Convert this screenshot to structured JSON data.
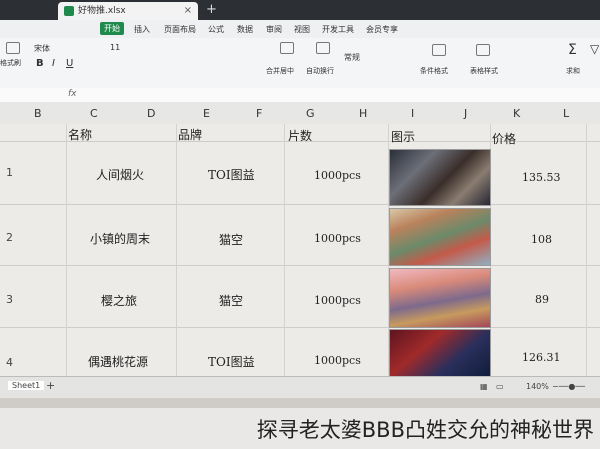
{
  "window": {
    "tab_title": "好物推.xlsx",
    "tab_close": "×",
    "new_tab": "+"
  },
  "ribbon_tabs": [
    "开始",
    "插入",
    "页面布局",
    "公式",
    "数据",
    "审阅",
    "视图",
    "开发工具",
    "会员专享"
  ],
  "ribbon": {
    "font_name": "宋体",
    "font_size": "11",
    "labels": [
      "格式刷",
      "合并居中",
      "自动换行",
      "常规",
      "条件格式",
      "表格样式",
      "求和",
      "筛选"
    ]
  },
  "formula_bar": {
    "fx": "fx"
  },
  "columns": [
    "B",
    "C",
    "D",
    "E",
    "F",
    "G",
    "H",
    "I",
    "J",
    "K",
    "L"
  ],
  "table": {
    "headers": {
      "name": "名称",
      "brand": "品牌",
      "pieces": "片数",
      "image": "图示",
      "price": "价格"
    },
    "rows": [
      {
        "num": "1",
        "name": "人间烟火",
        "brand": "TOI图益",
        "pieces": "1000pcs",
        "price": "135.53"
      },
      {
        "num": "2",
        "name": "小镇的周末",
        "brand": "猫空",
        "pieces": "1000pcs",
        "price": "108"
      },
      {
        "num": "3",
        "name": "樱之旅",
        "brand": "猫空",
        "pieces": "1000pcs",
        "price": "89"
      },
      {
        "num": "4",
        "name": "偶遇桃花源",
        "brand": "TOI图益",
        "pieces": "1000pcs",
        "price": "126.31"
      }
    ]
  },
  "status": {
    "sheet_name": "Sheet1",
    "add_sheet": "+",
    "zoom": "140%"
  },
  "caption": "探寻老太婆BBB凸姓交允的神秘世界",
  "colors": {
    "accent": "#1f8a4c",
    "grid_bg": "#ecebe8"
  }
}
